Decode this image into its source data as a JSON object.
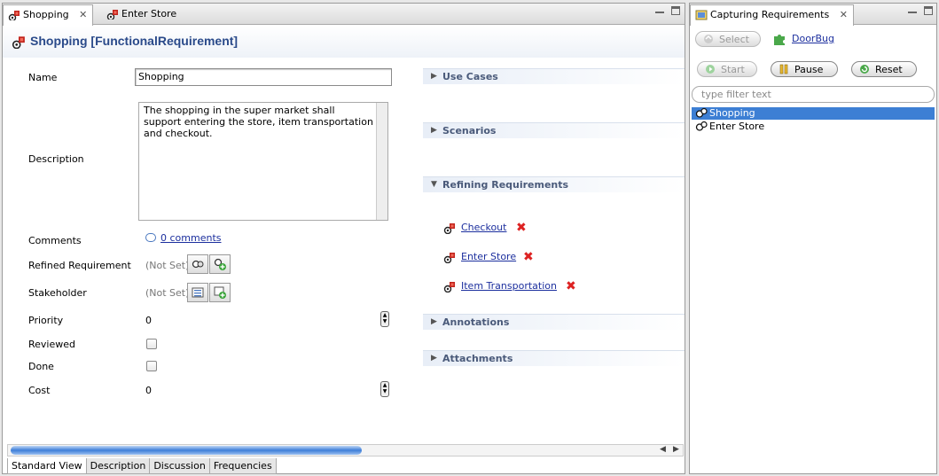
{
  "editor": {
    "tabs": [
      {
        "label": "Shopping",
        "active": true
      },
      {
        "label": "Enter Store",
        "active": false
      }
    ],
    "title": "Shopping [FunctionalRequirement]",
    "fields": {
      "name_label": "Name",
      "name_value": "Shopping",
      "description_label": "Description",
      "description_value": "The shopping in the super market shall\nsupport entering the store, item transportation\nand checkout.",
      "comments_label": "Comments",
      "comments_link": "0 comments",
      "refined_label": "Refined Requirement",
      "refined_value": "(Not Set)",
      "stakeholder_label": "Stakeholder",
      "stakeholder_value": "(Not Set)",
      "priority_label": "Priority",
      "priority_value": "0",
      "reviewed_label": "Reviewed",
      "reviewed_checked": false,
      "done_label": "Done",
      "done_checked": false,
      "cost_label": "Cost",
      "cost_value": "0"
    },
    "sections": {
      "use_cases": "Use Cases",
      "scenarios": "Scenarios",
      "refining": "Refining Requirements",
      "annotations": "Annotations",
      "attachments": "Attachments"
    },
    "refining_items": [
      "Checkout",
      "Enter Store",
      "Item Transportation"
    ],
    "bottom_tabs": [
      "Standard View",
      "Description",
      "Discussion",
      "Frequencies"
    ]
  },
  "panel": {
    "title": "Capturing Requirements",
    "select_label": "Select",
    "user_link": "DoorBug",
    "start_label": "Start",
    "pause_label": "Pause",
    "reset_label": "Reset",
    "filter_placeholder": "type filter text",
    "tree": [
      "Shopping",
      "Enter Store"
    ]
  },
  "colors": {
    "link": "#1c2f9e",
    "title": "#2a4a8a",
    "selection": "#3d7fd4",
    "delete": "#d22222"
  }
}
